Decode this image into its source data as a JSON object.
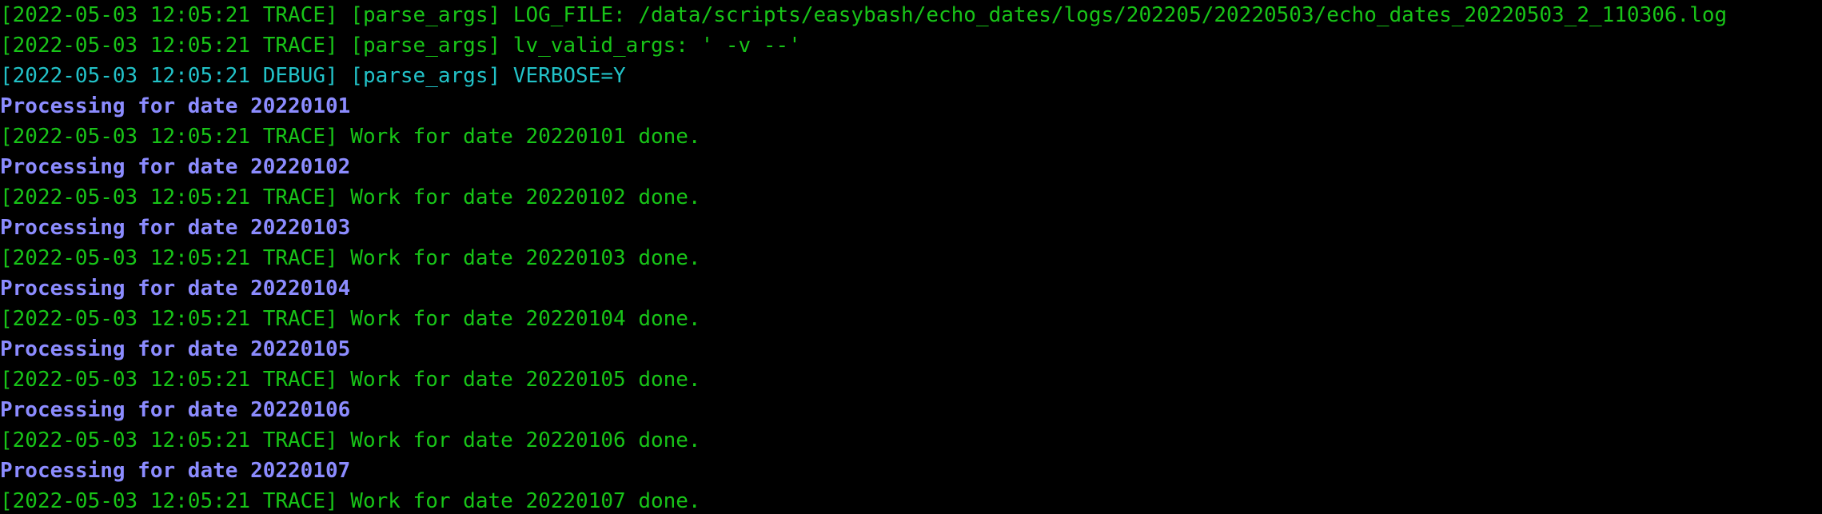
{
  "terminal": {
    "colors": {
      "background": "#000000",
      "trace": "#18c418",
      "debug": "#22c2c8",
      "info": "#8c8cff"
    },
    "lines": [
      {
        "level": "trace",
        "text": "[2022-05-03 12:05:21 TRACE] [parse_args] LOG_FILE: /data/scripts/easybash/echo_dates/logs/202205/20220503/echo_dates_20220503_2_110306.log"
      },
      {
        "level": "trace",
        "text": "[2022-05-03 12:05:21 TRACE] [parse_args] lv_valid_args: ' -v --'"
      },
      {
        "level": "debug",
        "text": "[2022-05-03 12:05:21 DEBUG] [parse_args] VERBOSE=Y"
      },
      {
        "level": "info",
        "text": "Processing for date 20220101"
      },
      {
        "level": "trace",
        "text": "[2022-05-03 12:05:21 TRACE] Work for date 20220101 done."
      },
      {
        "level": "info",
        "text": "Processing for date 20220102"
      },
      {
        "level": "trace",
        "text": "[2022-05-03 12:05:21 TRACE] Work for date 20220102 done."
      },
      {
        "level": "info",
        "text": "Processing for date 20220103"
      },
      {
        "level": "trace",
        "text": "[2022-05-03 12:05:21 TRACE] Work for date 20220103 done."
      },
      {
        "level": "info",
        "text": "Processing for date 20220104"
      },
      {
        "level": "trace",
        "text": "[2022-05-03 12:05:21 TRACE] Work for date 20220104 done."
      },
      {
        "level": "info",
        "text": "Processing for date 20220105"
      },
      {
        "level": "trace",
        "text": "[2022-05-03 12:05:21 TRACE] Work for date 20220105 done."
      },
      {
        "level": "info",
        "text": "Processing for date 20220106"
      },
      {
        "level": "trace",
        "text": "[2022-05-03 12:05:21 TRACE] Work for date 20220106 done."
      },
      {
        "level": "info",
        "text": "Processing for date 20220107"
      },
      {
        "level": "trace",
        "text": "[2022-05-03 12:05:21 TRACE] Work for date 20220107 done."
      }
    ]
  }
}
